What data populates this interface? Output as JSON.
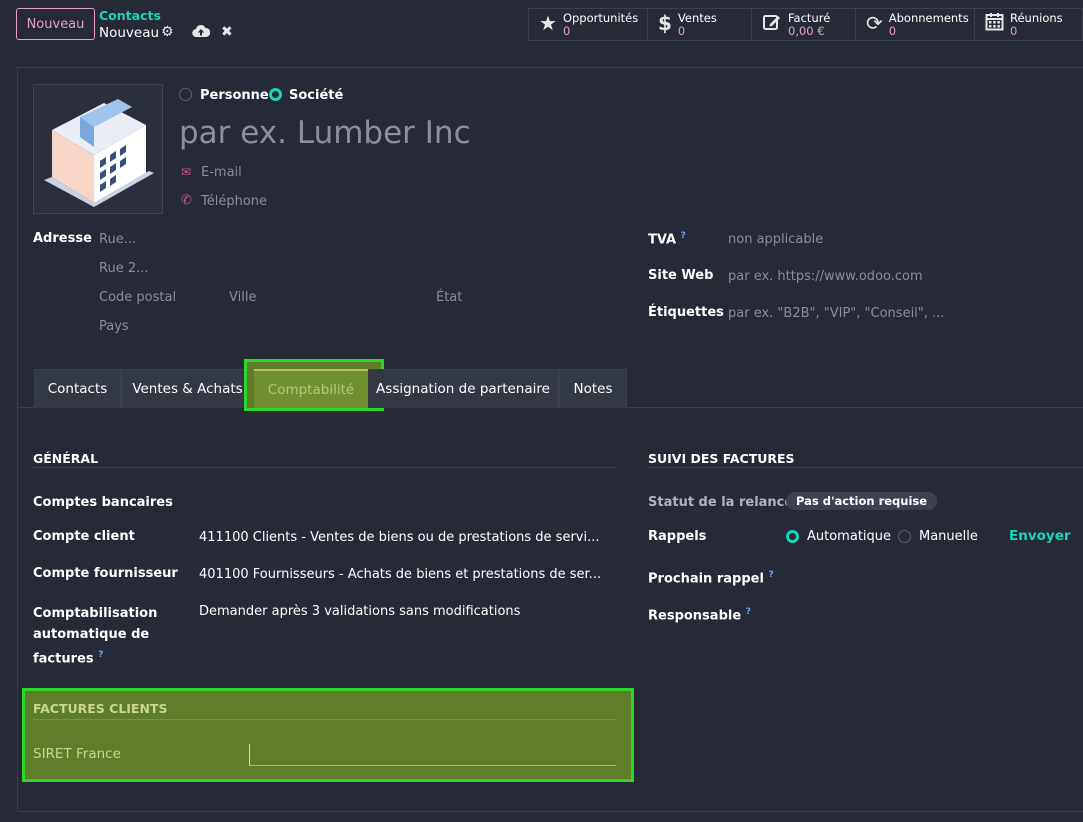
{
  "control_panel": {
    "new_button": "Nouveau",
    "breadcrumb_parent": "Contacts",
    "breadcrumb_current": "Nouveau",
    "smart_buttons": [
      {
        "label": "Opportunités",
        "value": "0",
        "icon": "star-icon"
      },
      {
        "label": "Ventes",
        "value": "0",
        "icon": "dollar-icon"
      },
      {
        "label": "Facturé",
        "value": "0,00 €",
        "icon": "invoice-edit-icon"
      },
      {
        "label": "Abonnements",
        "value": "0",
        "icon": "refresh-icon"
      },
      {
        "label": "Réunions",
        "value": "0",
        "icon": "calendar-icon"
      }
    ]
  },
  "form": {
    "type_options": {
      "person": "Personne",
      "company": "Société",
      "selected": "company"
    },
    "name_placeholder": "par ex. Lumber Inc",
    "email_placeholder": "E-mail",
    "phone_placeholder": "Téléphone",
    "address": {
      "label": "Adresse",
      "street": "Rue...",
      "street2": "Rue 2...",
      "zip": "Code postal",
      "city": "Ville",
      "state": "État",
      "country": "Pays"
    },
    "vat": {
      "label": "TVA",
      "placeholder": "non applicable"
    },
    "website": {
      "label": "Site Web",
      "placeholder": "par ex. https://www.odoo.com"
    },
    "tags": {
      "label": "Étiquettes",
      "placeholder": "par ex. \"B2B\", \"VIP\", \"Conseil\", ..."
    }
  },
  "tabs": [
    "Contacts",
    "Ventes & Achats",
    "Comptabilité",
    "Assignation de partenaire",
    "Notes"
  ],
  "active_tab": "Comptabilité",
  "accounting": {
    "general_title": "GÉNÉRAL",
    "bank_accounts_label": "Comptes bancaires",
    "receivable_label": "Compte client",
    "receivable_value": "411100 Clients - Ventes de biens ou de prestations de servi...",
    "payable_label": "Compte fournisseur",
    "payable_value": "401100 Fournisseurs - Achats de biens et prestations de ser...",
    "auto_post_label_1": "Comptabilisation",
    "auto_post_label_2": "automatique de",
    "auto_post_label_3": "factures",
    "auto_post_value": "Demander après 3 validations sans modifications",
    "invoice_followup_title": "SUIVI DES FACTURES",
    "followup_status_label": "Statut de la relance",
    "followup_status_value": "Pas d'action requise",
    "reminders_label": "Rappels",
    "reminder_auto": "Automatique",
    "reminder_manual": "Manuelle",
    "send_button": "Envoyer",
    "next_reminder_label": "Prochain rappel",
    "responsible_label": "Responsable",
    "customer_invoices_title": "FACTURES CLIENTS",
    "siret_label": "SIRET France",
    "siret_value": ""
  },
  "help_marker": "?",
  "colors": {
    "accent": "#1ad3bb",
    "brand": "#e5a0c4",
    "highlight": "#2fd62a"
  }
}
